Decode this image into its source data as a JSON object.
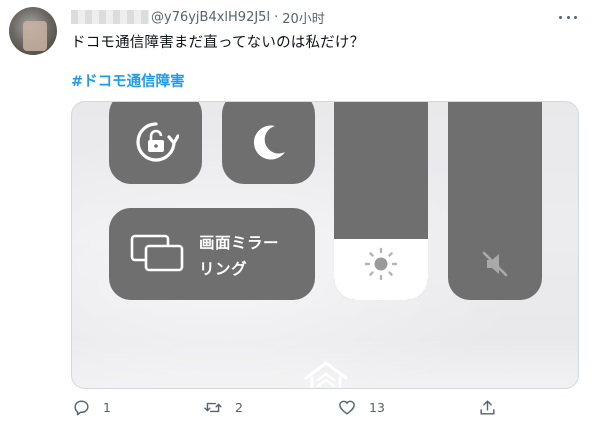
{
  "tweet": {
    "handle_visible": "@y76yjB4xlH92J5l",
    "separator": "·",
    "time": "20小时",
    "text": "ドコモ通信障害まだ直ってないのは私だけ？",
    "hashtag": "#ドコモ通信障害"
  },
  "control_center": {
    "screen_mirroring_line1": "画面ミラー",
    "screen_mirroring_line2": "リング",
    "brightness_level": 0.28,
    "colors": {
      "tile": "#6f6f70",
      "background": "#ececef",
      "brightness_fill": "#ffffff"
    }
  },
  "actions": {
    "reply_count": "1",
    "retweet_count": "2",
    "like_count": "13"
  },
  "icons": [
    "reply-icon",
    "retweet-icon",
    "like-icon",
    "share-icon",
    "more-icon",
    "rotation-lock-icon",
    "moon-icon",
    "screen-mirroring-icon",
    "brightness-icon",
    "mute-icon",
    "home-icon"
  ]
}
